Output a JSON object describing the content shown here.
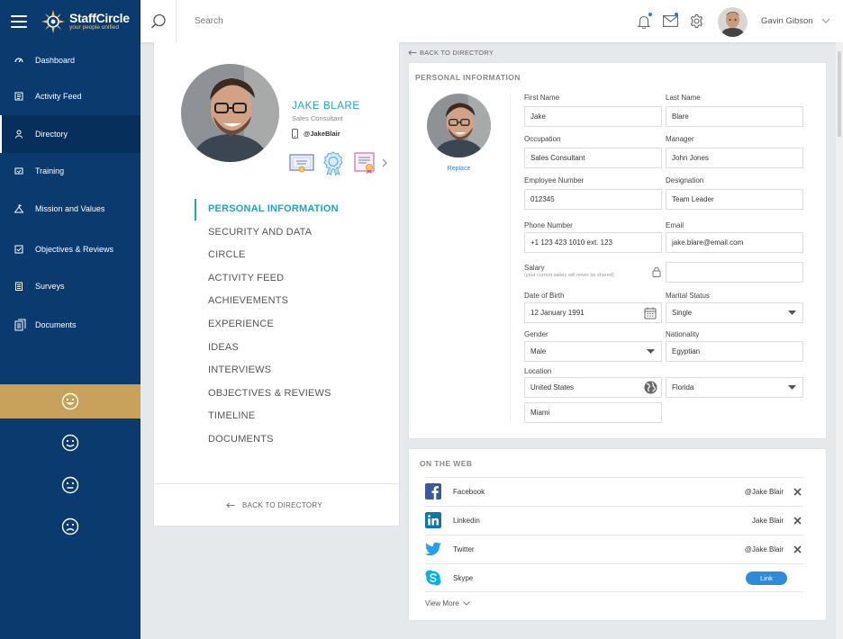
{
  "app": {
    "name": "StaffCircle",
    "tagline": "your people unified"
  },
  "colors": {
    "sidebar": "#0b3a6e",
    "accent": "#21a3c4",
    "mood_active": "#c8a25a",
    "link_button": "#2f8ad9"
  },
  "sidebar": {
    "items": [
      {
        "label": "Dashboard",
        "icon": "dashboard-icon"
      },
      {
        "label": "Activity Feed",
        "icon": "activity-feed-icon"
      },
      {
        "label": "Directory",
        "icon": "user-icon",
        "active": true
      },
      {
        "label": "Training",
        "icon": "training-icon"
      },
      {
        "label": "Mission and Values",
        "icon": "mission-icon"
      },
      {
        "label": "Objectives & Reviews",
        "icon": "objectives-icon"
      },
      {
        "label": "Surveys",
        "icon": "surveys-icon"
      },
      {
        "label": "Documents",
        "icon": "documents-icon"
      }
    ],
    "moods": [
      "very-happy-face-icon",
      "happy-face-icon",
      "neutral-face-icon",
      "sad-face-icon"
    ],
    "active_mood": 0
  },
  "header": {
    "search_placeholder": "Search",
    "user_name": "Gavin Gibson",
    "icons": [
      "bell-icon",
      "mail-icon",
      "gear-icon"
    ]
  },
  "profile": {
    "name": "JAKE BLARE",
    "role": "Sales Consultant",
    "handle": "@JakeBlair",
    "badges": [
      "certificate-badge-icon",
      "award-ribbon-icon",
      "diploma-icon"
    ],
    "menu": [
      "PERSONAL INFORMATION",
      "SECURITY AND DATA",
      "CIRCLE",
      "ACTIVITY FEED",
      "ACHIEVEMENTS",
      "EXPERIENCE",
      "IDEAS",
      "INTERVIEWS",
      "OBJECTIVES & REVIEWS",
      "TIMELINE",
      "DOCUMENTS"
    ],
    "active_menu": 0,
    "back_label": "BACK TO DIRECTORY"
  },
  "personal_info": {
    "back_label": "BACK TO DIRECTORY",
    "title": "PERSONAL INFORMATION",
    "replace_label": "Replace",
    "labels": {
      "first_name": "First Name",
      "last_name": "Last Name",
      "occupation": "Occupation",
      "manager": "Manager",
      "employee_number": "Employee Number",
      "designation": "Designation",
      "phone": "Phone Number",
      "email": "Email",
      "salary": "Salary",
      "salary_note": "(your current salary will never be shared)",
      "dob": "Date of Birth",
      "marital_status": "Marital Status",
      "gender": "Gender",
      "nationality": "Nationality",
      "location": "Location"
    },
    "values": {
      "first_name": "Jake",
      "last_name": "Blare",
      "occupation": "Sales Consultant",
      "manager": "John Jones",
      "employee_number": "012345",
      "designation": "Team Leader",
      "phone": "+1 123 423 1010 ext. 123",
      "email": "jake.blare@email.com",
      "salary": "",
      "dob": "12 January 1991",
      "marital_status": "Single",
      "gender": "Male",
      "nationality": "Egyptian",
      "country": "United States",
      "state": "Florida",
      "city": "Miami"
    }
  },
  "on_the_web": {
    "title": "ON THE WEB",
    "rows": [
      {
        "name": "Facebook",
        "handle": "@Jake Blair",
        "icon": "facebook-icon",
        "action": "remove"
      },
      {
        "name": "Linkedin",
        "handle": "Jake Blair",
        "icon": "linkedin-icon",
        "action": "remove"
      },
      {
        "name": "Twitter",
        "handle": "@Jake.Blair",
        "icon": "twitter-icon",
        "action": "remove"
      },
      {
        "name": "Skype",
        "handle": "",
        "icon": "skype-icon",
        "action": "link"
      }
    ],
    "link_label": "Link",
    "view_more": "View More"
  }
}
